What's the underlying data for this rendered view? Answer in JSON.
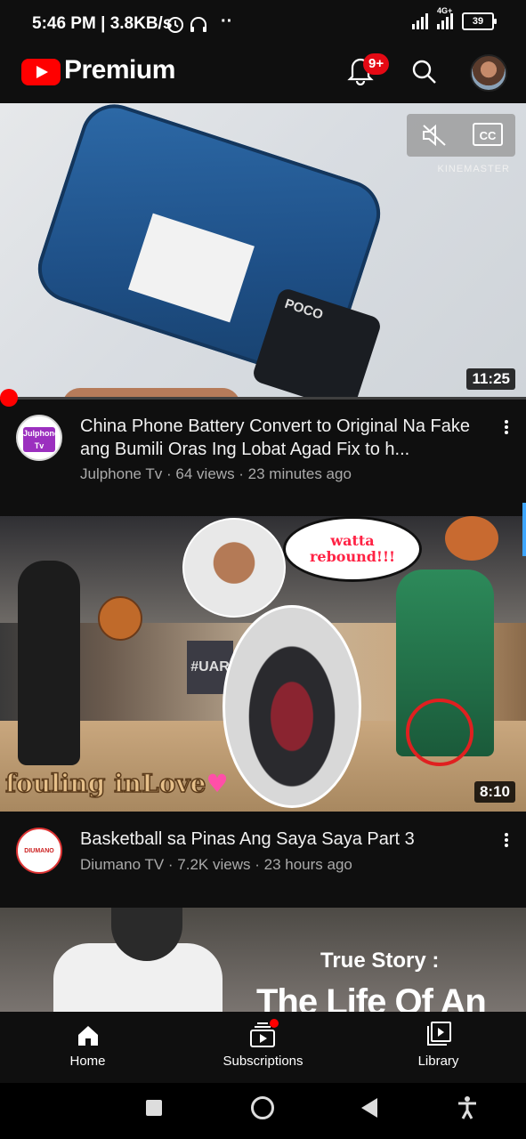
{
  "status_bar": {
    "time": "5:46 PM",
    "speed": "3.8KB/s",
    "network": "4G+",
    "battery": "39"
  },
  "header": {
    "brand": "Premium",
    "notification_badge": "9+"
  },
  "videos": [
    {
      "title": "China Phone Battery Convert to Original Na Fake ang Bumili Oras Ing Lobat Agad Fix to h...",
      "channel": "Julphone Tv",
      "views": "64 views",
      "age": "23 minutes ago",
      "duration": "11:25",
      "channel_avatar_text": "Julphone Tv",
      "thumb_watermark": "KINEMASTER",
      "thumb_text": "POCO"
    },
    {
      "title": "Basketball sa Pinas Ang Saya Saya Part 3",
      "channel": "Diumano TV",
      "views": "7.2K views",
      "age": "23 hours ago",
      "duration": "8:10",
      "thumb_caption": "fouling inLove",
      "thumb_bubble": "watta rebound!!!",
      "thumb_banner": "#UAR",
      "channel_avatar_text": "DIUMANO"
    },
    {
      "thumb_text_1": "True Story :",
      "thumb_text_2": "The Life Of An"
    }
  ],
  "bottom_nav": [
    {
      "label": "Home",
      "icon": "home-icon"
    },
    {
      "label": "Subscriptions",
      "icon": "subscriptions-icon"
    },
    {
      "label": "Library",
      "icon": "library-icon"
    }
  ],
  "colors": {
    "background": "#0f0f0f",
    "brand_red": "#ff0000",
    "secondary_text": "#aaaaaa"
  }
}
